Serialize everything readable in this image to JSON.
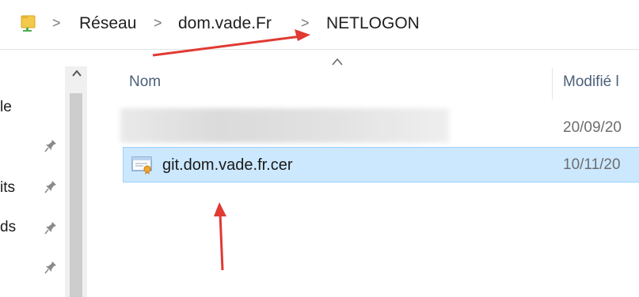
{
  "breadcrumb": {
    "items": [
      {
        "label": "Réseau"
      },
      {
        "label": "dom.vade.Fr"
      },
      {
        "label": "NETLOGON"
      }
    ],
    "separator": ">"
  },
  "nav_pane": {
    "items": [
      {
        "label": "le"
      },
      {
        "label": "its"
      },
      {
        "label": "ds"
      }
    ]
  },
  "file_list": {
    "columns": [
      {
        "label": "Nom"
      },
      {
        "label": "Modifié l"
      }
    ],
    "rows": [
      {
        "name": "",
        "modified": "20/09/20",
        "blurred": true,
        "selected": false
      },
      {
        "name": "git.dom.vade.fr.cer",
        "modified": "10/11/20",
        "blurred": false,
        "selected": true,
        "icon": "certificate-icon"
      }
    ]
  },
  "colors": {
    "selection": "#cce8ff",
    "selection_border": "#99d1ff",
    "annotation_arrow": "#e03a33",
    "header_text": "#4c607a"
  }
}
